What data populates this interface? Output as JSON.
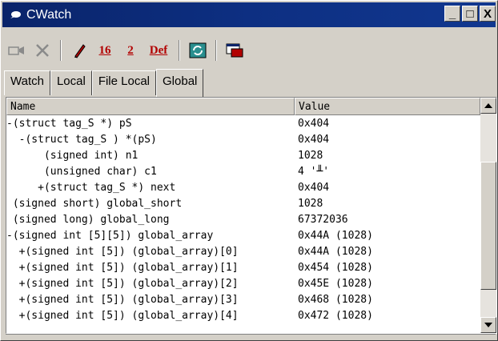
{
  "window": {
    "title": "CWatch",
    "buttons": {
      "minimize": "_",
      "maximize": "□",
      "close": "X"
    }
  },
  "toolbar": {
    "items": [
      {
        "name": "add-watch",
        "icon": "add-watch-icon"
      },
      {
        "name": "delete",
        "icon": "delete-icon"
      },
      {
        "name": "edit",
        "icon": "pencil-icon"
      },
      {
        "name": "hex",
        "label": "16"
      },
      {
        "name": "binary",
        "label": "2"
      },
      {
        "name": "default",
        "label": "Def"
      },
      {
        "name": "refresh",
        "icon": "refresh-icon"
      },
      {
        "name": "dock",
        "icon": "dock-window-icon"
      }
    ]
  },
  "tabs": [
    {
      "label": "Watch",
      "active": false
    },
    {
      "label": "Local",
      "active": false
    },
    {
      "label": "File Local",
      "active": false
    },
    {
      "label": "Global",
      "active": true
    }
  ],
  "grid": {
    "headers": {
      "name": "Name",
      "value": "Value"
    },
    "rows": [
      {
        "name": "-(struct tag_S *) pS",
        "value": "0x404"
      },
      {
        "name": "  -(struct tag_S ) *(pS)",
        "value": "0x404"
      },
      {
        "name": "      (signed int) n1",
        "value": "1028"
      },
      {
        "name": "      (unsigned char) c1",
        "value": "4 '╨'"
      },
      {
        "name": "     +(struct tag_S *) next",
        "value": "0x404"
      },
      {
        "name": " (signed short) global_short",
        "value": "1028"
      },
      {
        "name": " (signed long) global_long",
        "value": "67372036"
      },
      {
        "name": "-(signed int [5][5]) global_array",
        "value": "0x44A (1028)"
      },
      {
        "name": "  +(signed int [5]) (global_array)[0]",
        "value": "0x44A (1028)"
      },
      {
        "name": "  +(signed int [5]) (global_array)[1]",
        "value": "0x454 (1028)"
      },
      {
        "name": "  +(signed int [5]) (global_array)[2]",
        "value": "0x45E (1028)"
      },
      {
        "name": "  +(signed int [5]) (global_array)[3]",
        "value": "0x468 (1028)"
      },
      {
        "name": "  +(signed int [5]) (global_array)[4]",
        "value": "0x472 (1028)"
      }
    ]
  },
  "colors": {
    "title_bar": "#0a246a",
    "toolbar_text_red": "#b20000",
    "face": "#d4d0c8"
  }
}
